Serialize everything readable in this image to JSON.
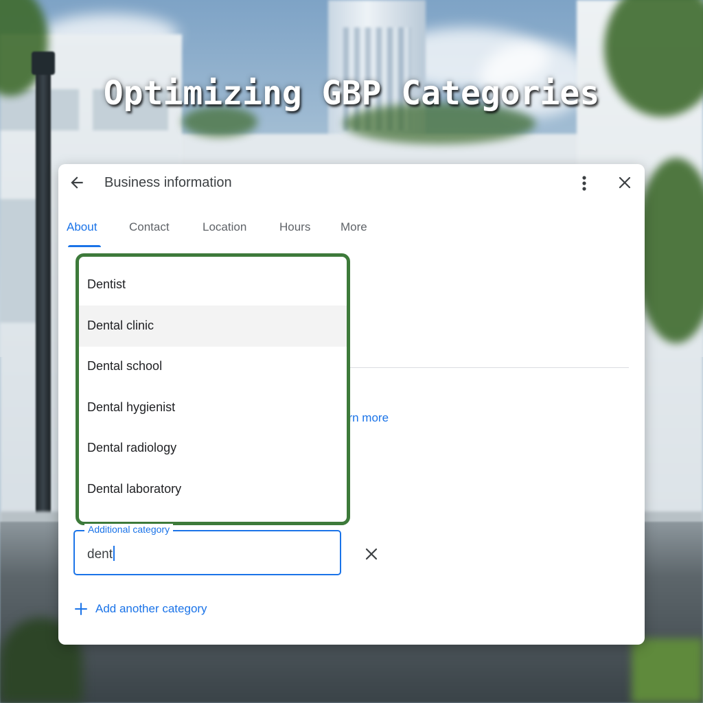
{
  "title": "Optimizing GBP Categories",
  "dialog": {
    "header": {
      "title": "Business information",
      "back_icon": "arrow-back-icon",
      "more_icon": "more-vert-icon",
      "close_icon": "close-icon"
    },
    "tabs": [
      {
        "label": "About",
        "active": true
      },
      {
        "label": "Contact",
        "active": false
      },
      {
        "label": "Location",
        "active": false
      },
      {
        "label": "Hours",
        "active": false
      },
      {
        "label": "More",
        "active": false
      }
    ],
    "learn_more_partial": "arn more",
    "dropdown": {
      "options": [
        {
          "label": "Dentist",
          "highlighted": false
        },
        {
          "label": "Dental clinic",
          "highlighted": true
        },
        {
          "label": "Dental school",
          "highlighted": false
        },
        {
          "label": "Dental hygienist",
          "highlighted": false
        },
        {
          "label": "Dental radiology",
          "highlighted": false
        },
        {
          "label": "Dental laboratory",
          "highlighted": false
        }
      ]
    },
    "additional_category": {
      "label": "Additional category",
      "value": "dent",
      "clear_icon": "close-icon"
    },
    "add_another": {
      "label": "Add another category",
      "icon": "plus-icon"
    }
  },
  "colors": {
    "accent": "#1a73e8",
    "highlight_border": "#3d7a3a",
    "text": "#202124",
    "muted": "#5f6368"
  }
}
